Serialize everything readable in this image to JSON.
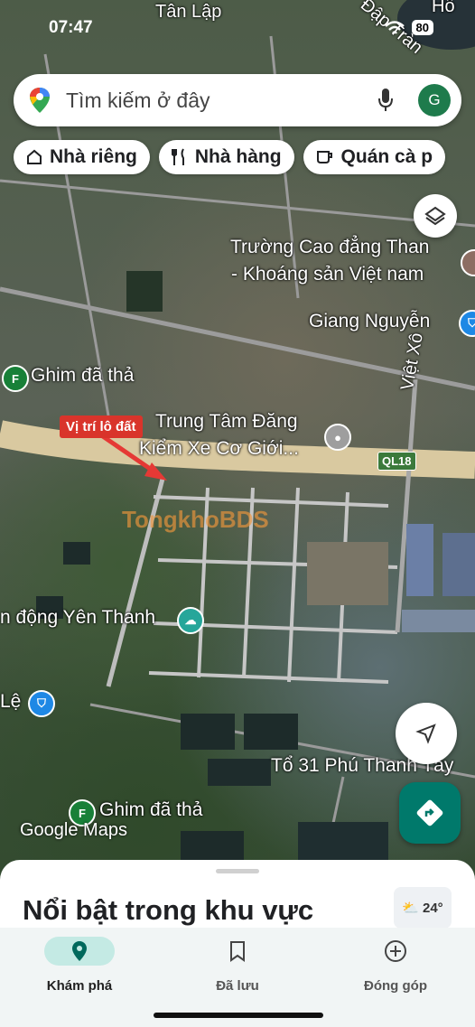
{
  "status_bar": {
    "time": "07:47",
    "battery": "80"
  },
  "search": {
    "placeholder": "Tìm kiếm ở đây",
    "avatar_letter": "G"
  },
  "chips": [
    {
      "label": "Nhà riêng",
      "icon": "home-icon"
    },
    {
      "label": "Nhà hàng",
      "icon": "restaurant-icon"
    },
    {
      "label": "Quán cà p",
      "icon": "cafe-icon"
    }
  ],
  "map_labels": {
    "tan_lap": "Tân Lập",
    "dap_tran": "Đập Tràn",
    "ho": "Hồ",
    "truong_line1": "Trường Cao đẳng Than",
    "truong_line2": "- Khoáng sản Việt nam",
    "giang_nguyen": "Giang Nguyễn",
    "ghim1": "Ghim đã thả",
    "viet_xo": "Việt Xô",
    "trung_tam_line1": "Trung Tâm Đăng",
    "trung_tam_line2": "Kiểm Xe Cơ Giới...",
    "ql18": "QL18",
    "yen_thanh": "n động Yên Thanh",
    "le": "Lệ",
    "to31": "Tổ 31 Phú Thanh Tây",
    "ghim2": "Ghim đã thả",
    "google_maps": "Google Maps"
  },
  "marker_label": "Vị trí lô đất",
  "watermark": "TongkhoBDS",
  "sheet": {
    "title": "Nổi bật trong khu vực",
    "weather": "24°"
  },
  "nav": [
    {
      "label": "Khám phá",
      "icon": "explore-pin-icon",
      "active": true
    },
    {
      "label": "Đã lưu",
      "icon": "bookmark-icon",
      "active": false
    },
    {
      "label": "Đóng góp",
      "icon": "add-circle-icon",
      "active": false
    }
  ],
  "colors": {
    "accent": "#00796b",
    "marker_red": "#d9342b",
    "nav_active_bg": "#c4eae4"
  }
}
